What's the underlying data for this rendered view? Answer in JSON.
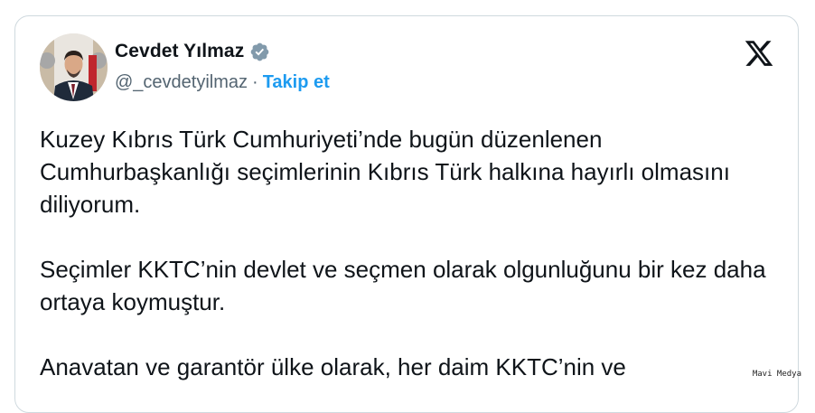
{
  "author": {
    "display_name": "Cevdet Yılmaz",
    "handle": "@_cevdetyilmaz",
    "separator": "·",
    "follow_label": "Takip et",
    "verified_icon": "verified-badge-icon",
    "verified_color": "#829aab"
  },
  "platform": {
    "logo_icon": "x-logo-icon"
  },
  "tweet": {
    "paragraphs": [
      "Kuzey Kıbrıs Türk Cumhuriyeti’nde bugün düzenlenen Cumhurbaşkanlığı seçimlerinin Kıbrıs Türk halkına hayırlı olmasını diliyorum.",
      "Seçimler KKTC’nin devlet ve seçmen olarak olgunluğunu bir kez daha ortaya koymuştur.",
      "Anavatan ve garantör ülke olarak, her daim KKTC’nin ve"
    ]
  },
  "watermark": "Mavi Medya",
  "colors": {
    "text": "#0f1419",
    "secondary": "#536471",
    "link": "#1d9bf0",
    "border": "#cfd9de"
  }
}
